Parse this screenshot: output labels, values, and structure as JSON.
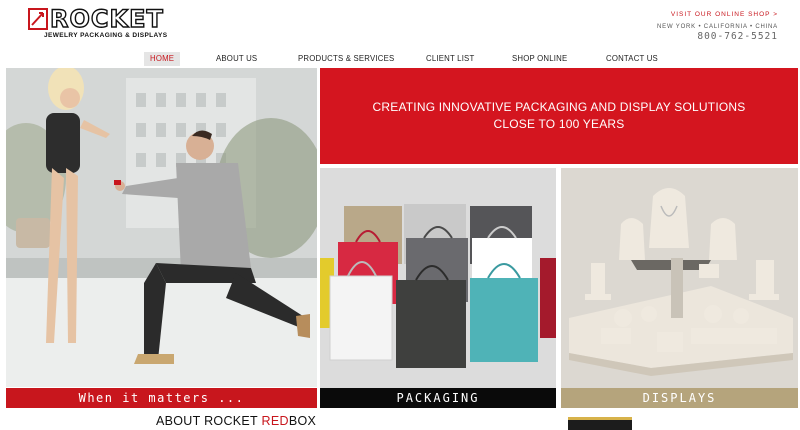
{
  "header": {
    "logo_text": "ROCKET",
    "logo_subtitle": "JEWELRY PACKAGING & DISPLAYS",
    "visit_link": "VISIT OUR ONLINE SHOP >",
    "locations": "NEW YORK • CALIFORNIA • CHINA",
    "phone": "800-762-5521"
  },
  "nav": {
    "items": [
      {
        "label": "HOME"
      },
      {
        "label": "ABOUT US"
      },
      {
        "label": "PRODUCTS & SERVICES"
      },
      {
        "label": "CLIENT LIST"
      },
      {
        "label": "SHOP ONLINE"
      },
      {
        "label": "CONTACT US"
      }
    ],
    "active": "HOME"
  },
  "hero": {
    "caption": "When it matters ..."
  },
  "banner": {
    "text": "CREATING INNOVATIVE PACKAGING AND DISPLAY SOLUTIONS CLOSE TO 100 YEARS"
  },
  "tiles": {
    "packaging_label": "PACKAGING",
    "displays_label": "DISPLAYS"
  },
  "about": {
    "prefix": "ABOUT ROCKET ",
    "highlight": "RED",
    "suffix": "BOX"
  },
  "colors": {
    "brand_red": "#c8161d",
    "banner_red": "#d4151f",
    "displays_tan": "#b5a47c"
  }
}
